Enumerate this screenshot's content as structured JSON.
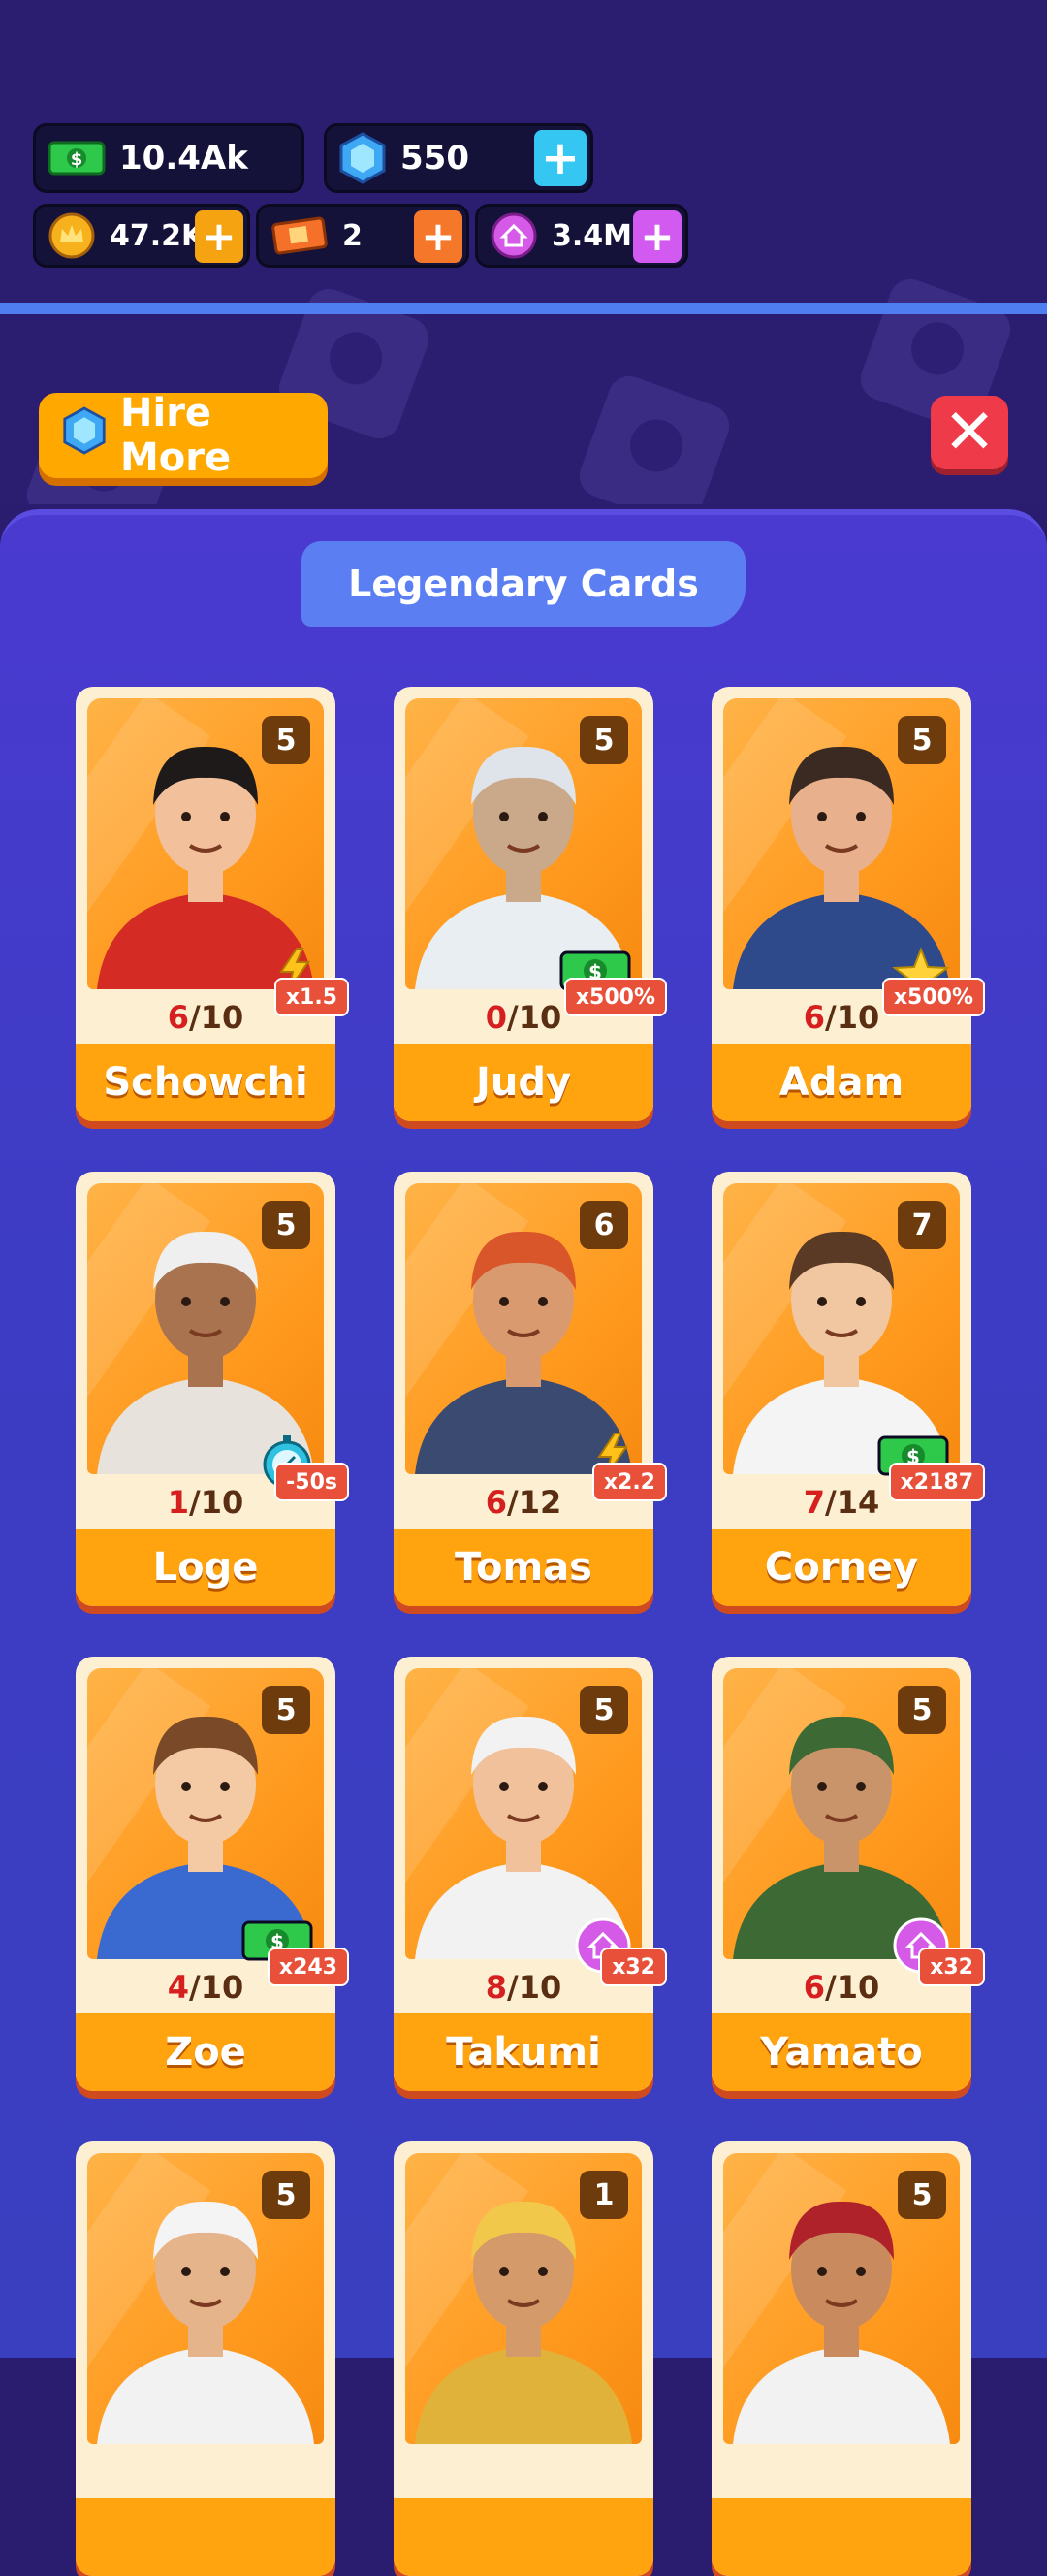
{
  "resources": {
    "cash": "10.4Ak",
    "gems": "550",
    "coins": "47.2K",
    "tickets": "2",
    "home": "3.4M"
  },
  "hire_button": "Hire More",
  "section_title": "Legendary Cards",
  "colors": {
    "background": "#2b1d70",
    "panel": "#4a3ad0",
    "card_orange": "#ffa30f",
    "badge_red": "#e8503a",
    "close_red": "#ef3a4a"
  },
  "cards": [
    {
      "name": "Schowchi",
      "level": "5",
      "current": "6",
      "total": "/10",
      "bonus": "x1.5",
      "bonus_icon": "lightning-icon"
    },
    {
      "name": "Judy",
      "level": "5",
      "current": "0",
      "total": "/10",
      "bonus": "x500%",
      "bonus_icon": "cash-icon"
    },
    {
      "name": "Adam",
      "level": "5",
      "current": "6",
      "total": "/10",
      "bonus": "x500%",
      "bonus_icon": "star-icon"
    },
    {
      "name": "Loge",
      "level": "5",
      "current": "1",
      "total": "/10",
      "bonus": "-50s",
      "bonus_icon": "stopwatch-icon"
    },
    {
      "name": "Tomas",
      "level": "6",
      "current": "6",
      "total": "/12",
      "bonus": "x2.2",
      "bonus_icon": "lightning-icon"
    },
    {
      "name": "Corney",
      "level": "7",
      "current": "7",
      "total": "/14",
      "bonus": "x2187",
      "bonus_icon": "cash-icon"
    },
    {
      "name": "Zoe",
      "level": "5",
      "current": "4",
      "total": "/10",
      "bonus": "x243",
      "bonus_icon": "cash-icon"
    },
    {
      "name": "Takumi",
      "level": "5",
      "current": "8",
      "total": "/10",
      "bonus": "x32",
      "bonus_icon": "home-icon"
    },
    {
      "name": "Yamato",
      "level": "5",
      "current": "6",
      "total": "/10",
      "bonus": "x32",
      "bonus_icon": "home-icon"
    },
    {
      "name": "",
      "level": "5",
      "current": "",
      "total": "",
      "bonus": "",
      "bonus_icon": ""
    },
    {
      "name": "",
      "level": "1",
      "current": "",
      "total": "",
      "bonus": "",
      "bonus_icon": ""
    },
    {
      "name": "",
      "level": "5",
      "current": "",
      "total": "",
      "bonus": "",
      "bonus_icon": ""
    }
  ]
}
